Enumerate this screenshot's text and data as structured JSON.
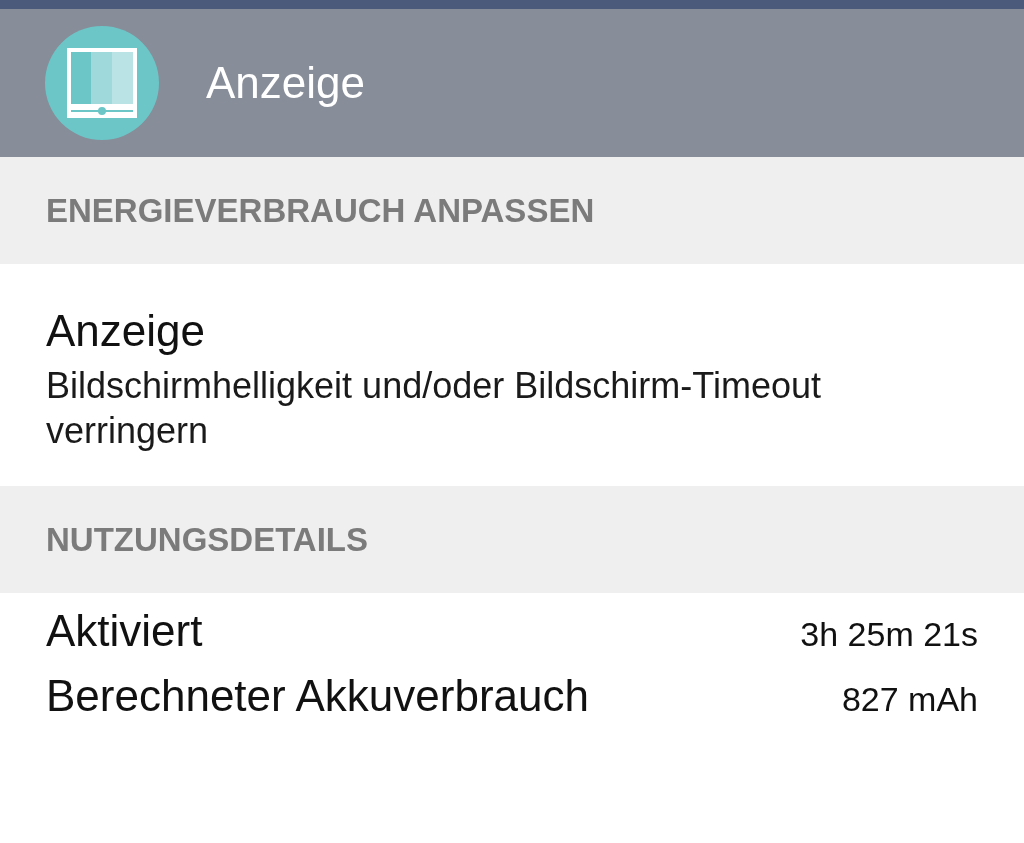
{
  "header": {
    "title": "Anzeige"
  },
  "sections": [
    {
      "heading": "ENERGIEVERBRAUCH ANPASSEN",
      "items": [
        {
          "kind": "suggestion",
          "title": "Anzeige",
          "description": "Bildschirmhelligkeit und/oder Bildschirm-Timeout verringern"
        }
      ]
    },
    {
      "heading": "NUTZUNGSDETAILS",
      "items": [
        {
          "kind": "detail",
          "label": "Aktiviert",
          "value": "3h 25m 21s"
        },
        {
          "kind": "detail",
          "label": "Berechneter Akkuverbrauch",
          "value": "827 mAh"
        }
      ]
    }
  ]
}
